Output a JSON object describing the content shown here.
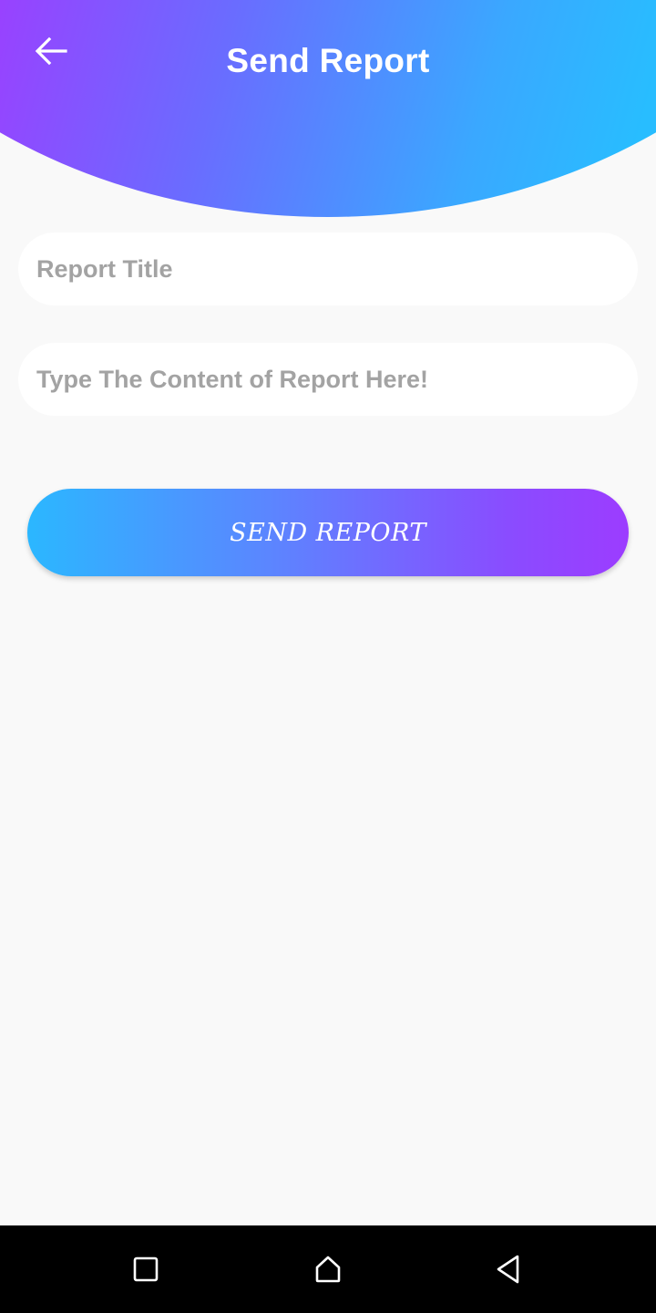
{
  "header": {
    "title": "Send Report",
    "back_icon": "arrow-left-icon",
    "gradient_start": "#b02cff",
    "gradient_end": "#28bdff"
  },
  "form": {
    "report_title_placeholder": "Report Title",
    "report_title_value": "",
    "report_content_placeholder": "Type The Content of Report Here!",
    "report_content_value": ""
  },
  "actions": {
    "send_label": "SEND REPORT",
    "gradient_start": "#2bb7ff",
    "gradient_end": "#9c3cff"
  },
  "nav_bar": {
    "items": [
      {
        "icon": "recents-square-icon"
      },
      {
        "icon": "home-icon"
      },
      {
        "icon": "back-triangle-icon"
      }
    ]
  }
}
